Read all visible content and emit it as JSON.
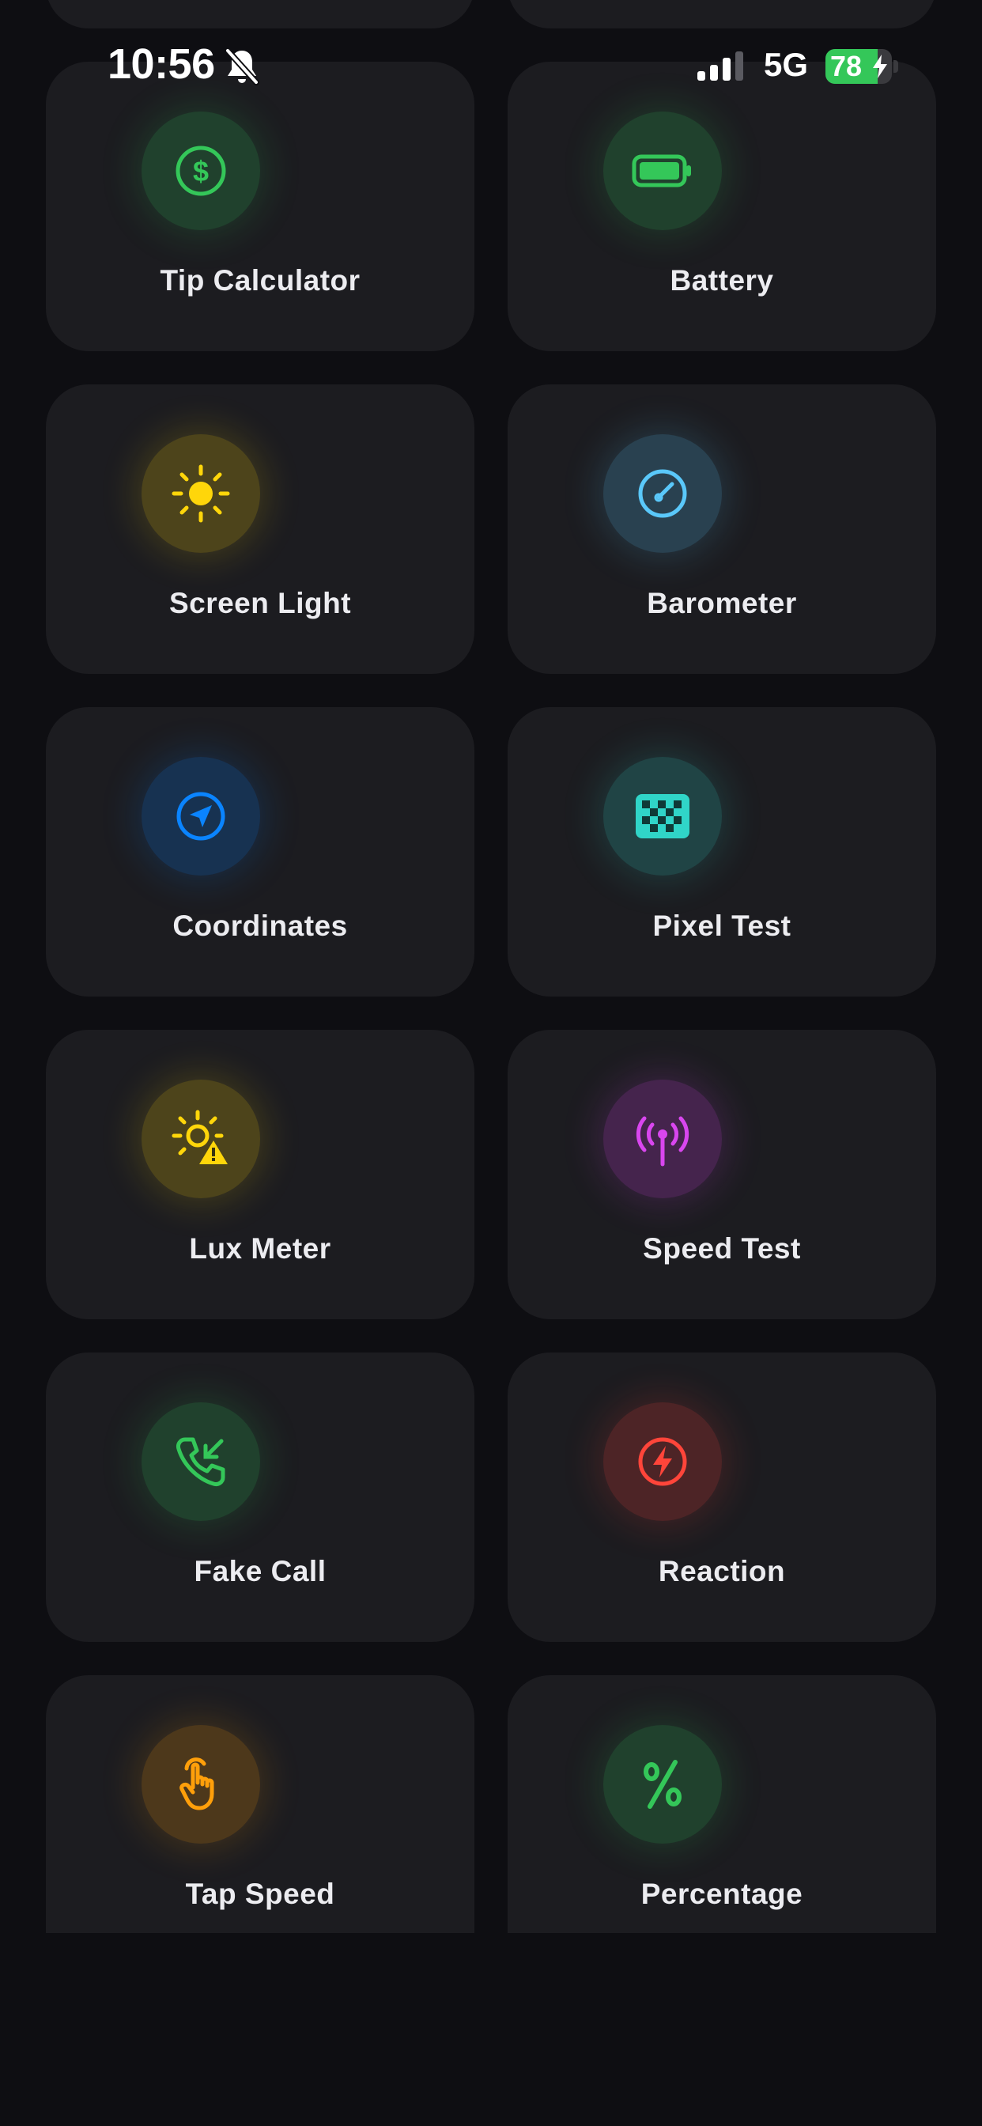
{
  "status_bar": {
    "time": "10:56",
    "network": "5G",
    "battery_level": "78",
    "battery_fraction": 0.78,
    "icons": [
      "bell-slash-icon",
      "cellular-signal-icon",
      "battery-charging-icon"
    ]
  },
  "tools": [
    {
      "label": "Tip Calculator",
      "icon": "dollar-sign-icon",
      "color": "#34c759"
    },
    {
      "label": "Battery",
      "icon": "battery-full-icon",
      "color": "#34c759"
    },
    {
      "label": "Screen Light",
      "icon": "sun-icon",
      "color": "#ffd60a"
    },
    {
      "label": "Barometer",
      "icon": "gauge-icon",
      "color": "#5ac8fa"
    },
    {
      "label": "Coordinates",
      "icon": "location-arrow-icon",
      "color": "#0a84ff"
    },
    {
      "label": "Pixel Test",
      "icon": "checkerboard-icon",
      "color": "#30d5c8"
    },
    {
      "label": "Lux Meter",
      "icon": "sun-warning-icon",
      "color": "#ffd60a"
    },
    {
      "label": "Speed Test",
      "icon": "antenna-signal-icon",
      "color": "#d946ef"
    },
    {
      "label": "Fake Call",
      "icon": "incoming-call-icon",
      "color": "#34c759"
    },
    {
      "label": "Reaction",
      "icon": "lightning-bolt-icon",
      "color": "#ff453a"
    },
    {
      "label": "Tap Speed",
      "icon": "hand-tap-icon",
      "color": "#ff9f0a"
    },
    {
      "label": "Percentage",
      "icon": "percent-icon",
      "color": "#34c759"
    }
  ]
}
